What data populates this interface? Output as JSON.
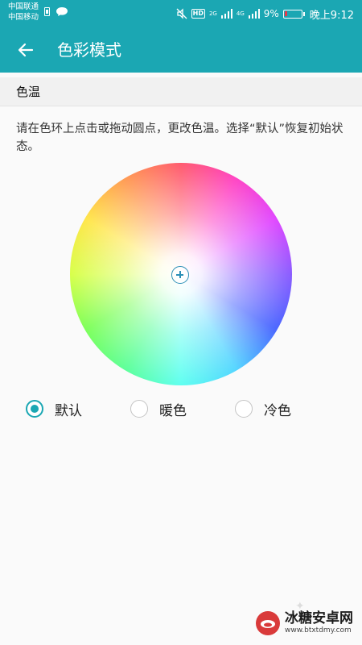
{
  "status_bar": {
    "carrier_1": "中国联通",
    "carrier_2": "中国移动",
    "network_1": "2G",
    "network_2": "4G",
    "hd": "HD",
    "battery_percent": "9%",
    "time": "晚上9:12",
    "icons": [
      "sim-card-icon",
      "message-icon",
      "mute-icon",
      "signal-icon",
      "battery-icon"
    ]
  },
  "app_bar": {
    "title": "色彩模式",
    "back_icon": "arrow-left-icon"
  },
  "section": {
    "title": "色温",
    "description": "请在色环上点击或拖动圆点，更改色温。选择“默认”恢复初始状态。"
  },
  "color_wheel": {
    "handle_icon": "crosshair-plus-icon"
  },
  "options": [
    {
      "label": "默认",
      "checked": true
    },
    {
      "label": "暖色",
      "checked": false
    },
    {
      "label": "冷色",
      "checked": false
    }
  ],
  "watermark": {
    "title": "冰糖安卓网",
    "url": "www.btxtdmy.com"
  },
  "colors": {
    "accent": "#1ba7b3",
    "section_bg": "#f1f1f1",
    "page_bg": "#fafafa",
    "battery_low": "#e4394b"
  }
}
